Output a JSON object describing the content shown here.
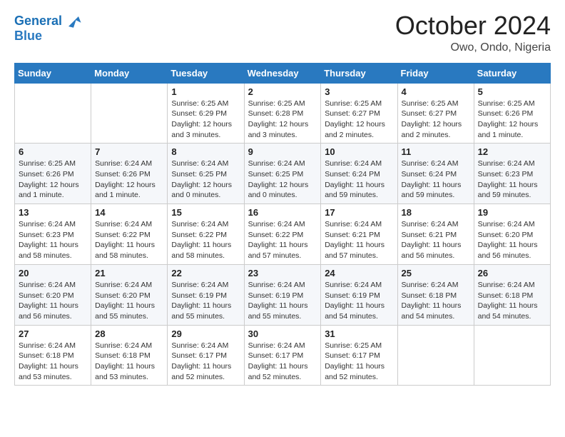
{
  "header": {
    "logo_line1": "General",
    "logo_line2": "Blue",
    "month": "October 2024",
    "location": "Owo, Ondo, Nigeria"
  },
  "weekdays": [
    "Sunday",
    "Monday",
    "Tuesday",
    "Wednesday",
    "Thursday",
    "Friday",
    "Saturday"
  ],
  "weeks": [
    [
      {
        "day": "",
        "info": ""
      },
      {
        "day": "",
        "info": ""
      },
      {
        "day": "1",
        "info": "Sunrise: 6:25 AM\nSunset: 6:29 PM\nDaylight: 12 hours and 3 minutes."
      },
      {
        "day": "2",
        "info": "Sunrise: 6:25 AM\nSunset: 6:28 PM\nDaylight: 12 hours and 3 minutes."
      },
      {
        "day": "3",
        "info": "Sunrise: 6:25 AM\nSunset: 6:27 PM\nDaylight: 12 hours and 2 minutes."
      },
      {
        "day": "4",
        "info": "Sunrise: 6:25 AM\nSunset: 6:27 PM\nDaylight: 12 hours and 2 minutes."
      },
      {
        "day": "5",
        "info": "Sunrise: 6:25 AM\nSunset: 6:26 PM\nDaylight: 12 hours and 1 minute."
      }
    ],
    [
      {
        "day": "6",
        "info": "Sunrise: 6:25 AM\nSunset: 6:26 PM\nDaylight: 12 hours and 1 minute."
      },
      {
        "day": "7",
        "info": "Sunrise: 6:24 AM\nSunset: 6:26 PM\nDaylight: 12 hours and 1 minute."
      },
      {
        "day": "8",
        "info": "Sunrise: 6:24 AM\nSunset: 6:25 PM\nDaylight: 12 hours and 0 minutes."
      },
      {
        "day": "9",
        "info": "Sunrise: 6:24 AM\nSunset: 6:25 PM\nDaylight: 12 hours and 0 minutes."
      },
      {
        "day": "10",
        "info": "Sunrise: 6:24 AM\nSunset: 6:24 PM\nDaylight: 11 hours and 59 minutes."
      },
      {
        "day": "11",
        "info": "Sunrise: 6:24 AM\nSunset: 6:24 PM\nDaylight: 11 hours and 59 minutes."
      },
      {
        "day": "12",
        "info": "Sunrise: 6:24 AM\nSunset: 6:23 PM\nDaylight: 11 hours and 59 minutes."
      }
    ],
    [
      {
        "day": "13",
        "info": "Sunrise: 6:24 AM\nSunset: 6:23 PM\nDaylight: 11 hours and 58 minutes."
      },
      {
        "day": "14",
        "info": "Sunrise: 6:24 AM\nSunset: 6:22 PM\nDaylight: 11 hours and 58 minutes."
      },
      {
        "day": "15",
        "info": "Sunrise: 6:24 AM\nSunset: 6:22 PM\nDaylight: 11 hours and 58 minutes."
      },
      {
        "day": "16",
        "info": "Sunrise: 6:24 AM\nSunset: 6:22 PM\nDaylight: 11 hours and 57 minutes."
      },
      {
        "day": "17",
        "info": "Sunrise: 6:24 AM\nSunset: 6:21 PM\nDaylight: 11 hours and 57 minutes."
      },
      {
        "day": "18",
        "info": "Sunrise: 6:24 AM\nSunset: 6:21 PM\nDaylight: 11 hours and 56 minutes."
      },
      {
        "day": "19",
        "info": "Sunrise: 6:24 AM\nSunset: 6:20 PM\nDaylight: 11 hours and 56 minutes."
      }
    ],
    [
      {
        "day": "20",
        "info": "Sunrise: 6:24 AM\nSunset: 6:20 PM\nDaylight: 11 hours and 56 minutes."
      },
      {
        "day": "21",
        "info": "Sunrise: 6:24 AM\nSunset: 6:20 PM\nDaylight: 11 hours and 55 minutes."
      },
      {
        "day": "22",
        "info": "Sunrise: 6:24 AM\nSunset: 6:19 PM\nDaylight: 11 hours and 55 minutes."
      },
      {
        "day": "23",
        "info": "Sunrise: 6:24 AM\nSunset: 6:19 PM\nDaylight: 11 hours and 55 minutes."
      },
      {
        "day": "24",
        "info": "Sunrise: 6:24 AM\nSunset: 6:19 PM\nDaylight: 11 hours and 54 minutes."
      },
      {
        "day": "25",
        "info": "Sunrise: 6:24 AM\nSunset: 6:18 PM\nDaylight: 11 hours and 54 minutes."
      },
      {
        "day": "26",
        "info": "Sunrise: 6:24 AM\nSunset: 6:18 PM\nDaylight: 11 hours and 54 minutes."
      }
    ],
    [
      {
        "day": "27",
        "info": "Sunrise: 6:24 AM\nSunset: 6:18 PM\nDaylight: 11 hours and 53 minutes."
      },
      {
        "day": "28",
        "info": "Sunrise: 6:24 AM\nSunset: 6:18 PM\nDaylight: 11 hours and 53 minutes."
      },
      {
        "day": "29",
        "info": "Sunrise: 6:24 AM\nSunset: 6:17 PM\nDaylight: 11 hours and 52 minutes."
      },
      {
        "day": "30",
        "info": "Sunrise: 6:24 AM\nSunset: 6:17 PM\nDaylight: 11 hours and 52 minutes."
      },
      {
        "day": "31",
        "info": "Sunrise: 6:25 AM\nSunset: 6:17 PM\nDaylight: 11 hours and 52 minutes."
      },
      {
        "day": "",
        "info": ""
      },
      {
        "day": "",
        "info": ""
      }
    ]
  ]
}
